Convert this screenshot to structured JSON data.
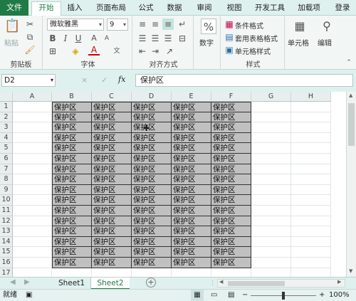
{
  "tabs": {
    "file": "文件",
    "items": [
      "开始",
      "插入",
      "页面布局",
      "公式",
      "数据",
      "审阅",
      "视图",
      "开发工具",
      "加载项"
    ],
    "login": "登录"
  },
  "ribbon": {
    "clipboard": {
      "paste": "粘贴",
      "label": "剪贴板"
    },
    "font": {
      "name": "微软雅黑",
      "size": "9",
      "label": "字体",
      "bold": "B",
      "italic": "I",
      "underline": "U",
      "grow": "A",
      "shrink": "A",
      "color_letter": "A"
    },
    "align": {
      "label": "对齐方式"
    },
    "number": {
      "button": "数字",
      "symbol": "%"
    },
    "styles": {
      "conditional": "条件格式",
      "table": "套用表格格式",
      "cell": "单元格样式",
      "label": "样式"
    },
    "cells": {
      "button": "单元格"
    },
    "editing": {
      "button": "编辑"
    }
  },
  "formula_bar": {
    "name_box": "D2",
    "cancel": "×",
    "enter": "✓",
    "fx": "fx",
    "value": "保护区"
  },
  "sheet": {
    "columns": [
      "A",
      "B",
      "C",
      "D",
      "E",
      "F",
      "G",
      "H"
    ],
    "rows": [
      "1",
      "2",
      "3",
      "4",
      "5",
      "6",
      "7",
      "8",
      "9",
      "10",
      "11",
      "12",
      "13",
      "14",
      "15",
      "16",
      "17"
    ],
    "cell_text": "保护区"
  },
  "sheet_tabs": {
    "items": [
      "Sheet1",
      "Sheet2"
    ],
    "active": "Sheet2",
    "add": "+"
  },
  "status_bar": {
    "ready": "就绪",
    "zoom": "100%",
    "minus": "−",
    "plus": "+"
  },
  "colors": {
    "file_green": "#1f7a45",
    "filled_cell": "#c0c0c0",
    "active_tab_text": "#1f7a45"
  }
}
